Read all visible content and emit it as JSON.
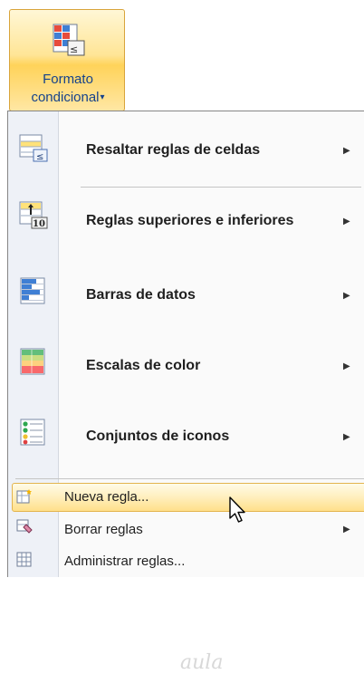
{
  "ribbon": {
    "line1": "Formato",
    "line2": "condicional",
    "arrow": "▾",
    "icon": "conditional-format-icon"
  },
  "menu": {
    "items": [
      {
        "label": "Resaltar reglas de celdas",
        "icon": "highlight-cells-rules-icon",
        "arrow": "▶"
      },
      {
        "label": "Reglas superiores e inferiores",
        "icon": "top-bottom-rules-icon",
        "arrow": "▶"
      },
      {
        "label": "Barras de datos",
        "icon": "data-bars-icon",
        "arrow": "▶"
      },
      {
        "label": "Escalas de color",
        "icon": "color-scales-icon",
        "arrow": "▶"
      },
      {
        "label": "Conjuntos de iconos",
        "icon": "icon-sets-icon",
        "arrow": "▶"
      }
    ],
    "commands": [
      {
        "label": "Nueva regla...",
        "icon": "new-rule-icon"
      },
      {
        "label": "Borrar reglas",
        "icon": "clear-rules-icon",
        "arrow": "▶"
      },
      {
        "label": "Administrar reglas...",
        "icon": "manage-rules-icon"
      }
    ]
  },
  "watermark": "aula",
  "colors": {
    "hover": "#ffe08a",
    "gutter": "#eef1f7",
    "ribbon_text": "#15428b"
  }
}
